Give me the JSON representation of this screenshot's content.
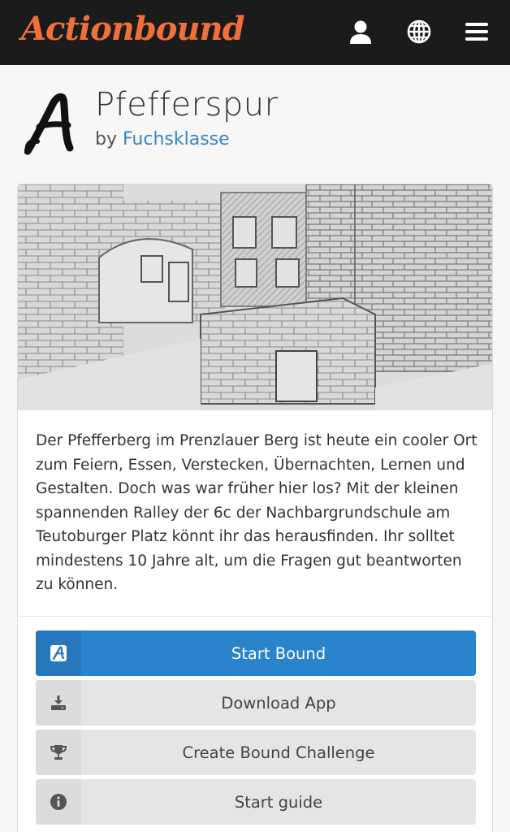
{
  "app": {
    "logo_text": "Actionbound"
  },
  "nav": {
    "icons": [
      "user-icon",
      "globe-icon",
      "menu-icon"
    ]
  },
  "bound": {
    "title": "Pfefferspur",
    "author_prefix": "by",
    "author_name": "Fuchsklasse",
    "cover_image": "pencil sketch of brick buildings",
    "description": "Der Pfefferberg im Prenzlauer Berg ist heute ein cooler Ort zum Feiern, Essen, Verstecken, Übernachten, Lernen und Gestalten. Doch was war früher hier los? Mit der kleinen spannenden Ralley der 6c der Nachbargrundschule am Teutoburger Platz könnt ihr das herausfinden. Ihr solltet mindestens 10 Jahre alt, um die Fragen gut beantworten zu können."
  },
  "actions": {
    "start_label": "Start Bound",
    "download_label": "Download App",
    "challenge_label": "Create Bound Challenge",
    "guide_label": "Start guide"
  },
  "colors": {
    "brand": "#f0703c",
    "topbar": "#1b1b1b",
    "primary_button": "#2b83cc",
    "link": "#3a86c2"
  }
}
